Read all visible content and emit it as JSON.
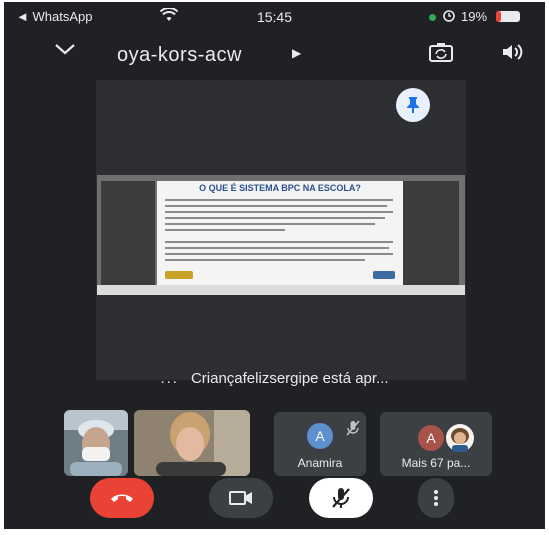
{
  "status_bar": {
    "back_label": "◄ WhatsApp",
    "time": "15:45",
    "battery": "19%",
    "battery_level": 0.19,
    "icons": [
      "wifi-icon",
      "alarm-icon",
      "battery-icon"
    ]
  },
  "meeting": {
    "title": "oya-kors-acw",
    "header_icons": [
      "chevron-down-icon",
      "play-icon",
      "camera-switch-icon",
      "speaker-icon"
    ],
    "pin_icon": "pin-icon"
  },
  "presentation": {
    "slide_title": "O QUE É SISTEMA BPC NA ESCOLA?",
    "caption": "Criançafelizsergipe está apr...",
    "caption_prefix": "..."
  },
  "participants": [
    {
      "kind": "video",
      "label": ""
    },
    {
      "kind": "video",
      "label": ""
    },
    {
      "kind": "avatar",
      "initial": "A",
      "name": "Anamira",
      "avatar_color": "#5f8fcf",
      "icons": [
        "mic-off-icon"
      ]
    },
    {
      "kind": "avatar",
      "initial": "A",
      "name": "Mais 67 pa...",
      "avatar_color": "#a8524a"
    }
  ],
  "controls": {
    "icons": [
      "end-call-icon",
      "video-camera-icon",
      "mic-off-icon",
      "more-vert-icon"
    ],
    "colors": {
      "end_call": "#ea4335",
      "control_bg": "#3c4043",
      "mic_bg": "#ffffff"
    }
  },
  "colors": {
    "background": "#202124",
    "text": "#e8eaed",
    "accent": "#1a73e8"
  }
}
